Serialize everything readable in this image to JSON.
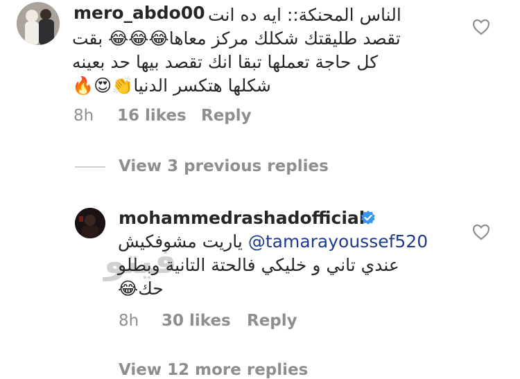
{
  "comment1": {
    "username": "mero_abdo00",
    "lines": [
      "الناس المحنكة:: ايه ده انت",
      "تقصد طليقتك شكلك مركز معاها😂😂😂 بقت",
      "كل حاجة تعملها تبقا انك تقصد بيها حد بعينه",
      "شكلها هتكسر الدنيا👏😍🔥"
    ],
    "time": "8h",
    "likes": "16 likes",
    "reply": "Reply"
  },
  "view_previous": "View 3 previous replies",
  "comment2": {
    "username": "mohammedrashadofficial",
    "mention": "@tamarayoussef520",
    "line1_rest": "ياريت مشوفكيش",
    "line2": "عندي تاني و خليكي فالحتة التانية وبطلو",
    "line3": "حك😂",
    "time": "8h",
    "likes": "30 likes",
    "reply": "Reply"
  },
  "watermark": "فيتو",
  "view_more": "View 12 more replies",
  "icons": {
    "heart": "heart-icon",
    "verified": "verified-badge-icon",
    "colors": {
      "verified": "#3897f0",
      "muted": "#8e8e8e",
      "text": "#262626"
    }
  }
}
